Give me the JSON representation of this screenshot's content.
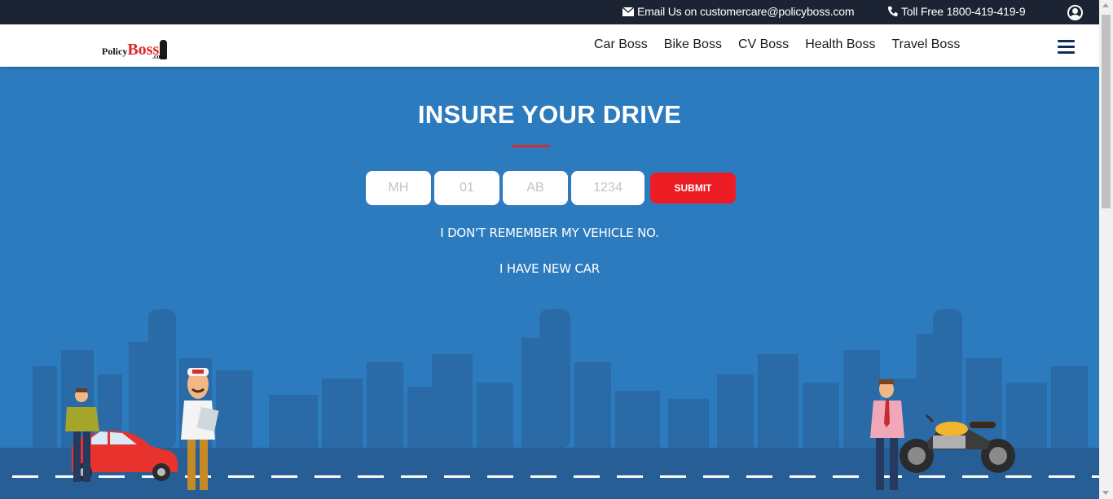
{
  "topbar": {
    "email_text": "Email Us on customercare@policyboss.com",
    "phone_text": "Toll Free 1800-419-419-9"
  },
  "logo": {
    "part1": "Policy",
    "part2": "Boss",
    "part3": ".com"
  },
  "nav": {
    "items": [
      {
        "label": "Car Boss"
      },
      {
        "label": "Bike Boss"
      },
      {
        "label": "CV Boss"
      },
      {
        "label": "Health Boss"
      },
      {
        "label": "Travel Boss"
      }
    ]
  },
  "hero": {
    "title": "INSURE YOUR DRIVE",
    "placeholders": {
      "state": "MH",
      "rto": "01",
      "series": "AB",
      "number": "1234"
    },
    "submit_label": "SUBMIT",
    "forgot_link": "I DON'T REMEMBER MY VEHICLE NO.",
    "newcar_link": "I HAVE NEW CAR"
  },
  "colors": {
    "topbar_bg": "#1c2433",
    "hero_bg": "#2d7bbf",
    "accent_red": "#ed1c24",
    "nav_icon": "#0f2d5c"
  },
  "icons": [
    "envelope-icon",
    "phone-icon",
    "user-account-icon",
    "hamburger-menu-icon"
  ]
}
